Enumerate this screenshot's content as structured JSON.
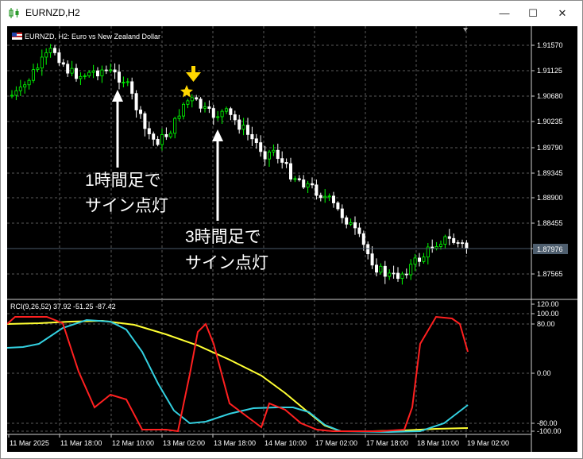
{
  "window": {
    "title": "EURNZD,H2",
    "minimize_glyph": "—",
    "maximize_glyph": "☐",
    "close_glyph": "✕"
  },
  "main_chart": {
    "header": "EURNZD, H2:  Euro vs New Zealand Dollar",
    "current_price": "1.87976",
    "price_ticks": [
      "1.91570",
      "1.91125",
      "1.90680",
      "1.90235",
      "1.89790",
      "1.89345",
      "1.88900",
      "1.88455",
      "1.88010",
      "1.87565"
    ]
  },
  "annotations": {
    "note1_line1": "1時間足で",
    "note1_line2": "サイン点灯",
    "note2_line1": "3時間足で",
    "note2_line2": "サイン点灯"
  },
  "rci": {
    "header": "RCI(9,26,52) 37.92 -51.25 -87.42",
    "ticks": [
      "120.00",
      "100.00",
      "80.00",
      "0.00",
      "-80.00",
      "-100.00"
    ]
  },
  "time_axis": [
    "11 Mar 2025",
    "11 Mar 18:00",
    "12 Mar 10:00",
    "13 Mar 02:00",
    "13 Mar 18:00",
    "14 Mar 10:00",
    "17 Mar 02:00",
    "17 Mar 18:00",
    "18 Mar 10:00",
    "19 Mar 02:00"
  ],
  "colors": {
    "background": "#000000",
    "bull_candle": "#00ff00",
    "bear_candle": "#ffffff",
    "rci_fast": "#ff2020",
    "rci_mid": "#33d0e0",
    "rci_slow": "#ffff33",
    "signal": "#ffd700"
  }
}
